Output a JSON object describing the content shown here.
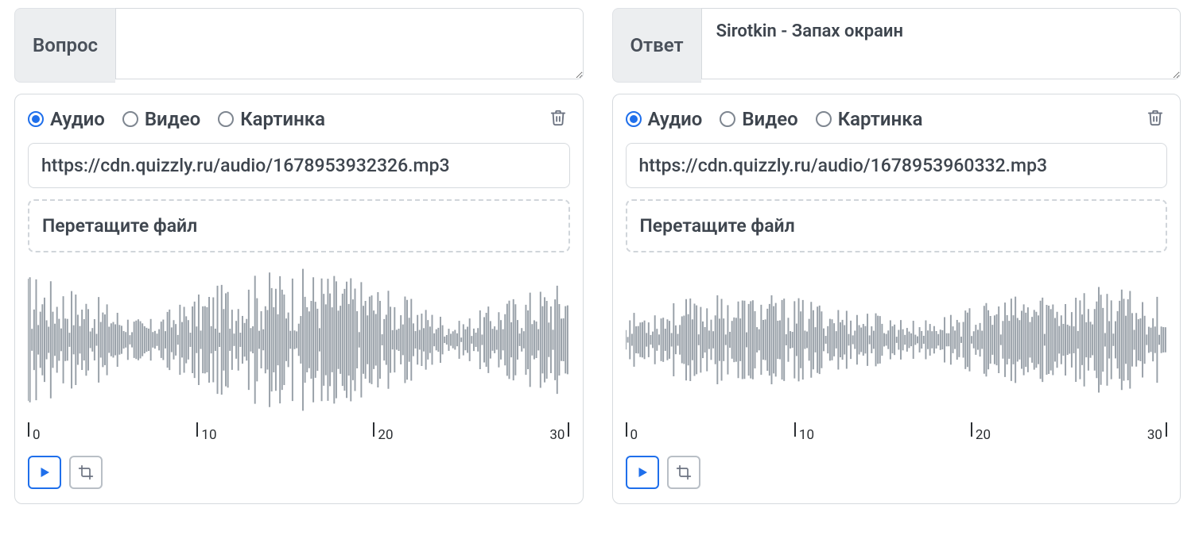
{
  "question": {
    "label": "Вопрос",
    "text": ""
  },
  "answer": {
    "label": "Ответ",
    "text": "Sirotkin - Запах окраин"
  },
  "media_types": {
    "audio": "Аудио",
    "video": "Видео",
    "image": "Картинка"
  },
  "q_media": {
    "selected": "audio",
    "url": "https://cdn.quizzly.ru/audio/1678953932326.mp3",
    "dropzone": "Перетащите файл",
    "ticks": [
      "0",
      "10",
      "20",
      "30"
    ]
  },
  "a_media": {
    "selected": "audio",
    "url": "https://cdn.quizzly.ru/audio/1678953960332.mp3",
    "dropzone": "Перетащите файл",
    "ticks": [
      "0",
      "10",
      "20",
      "30"
    ]
  }
}
